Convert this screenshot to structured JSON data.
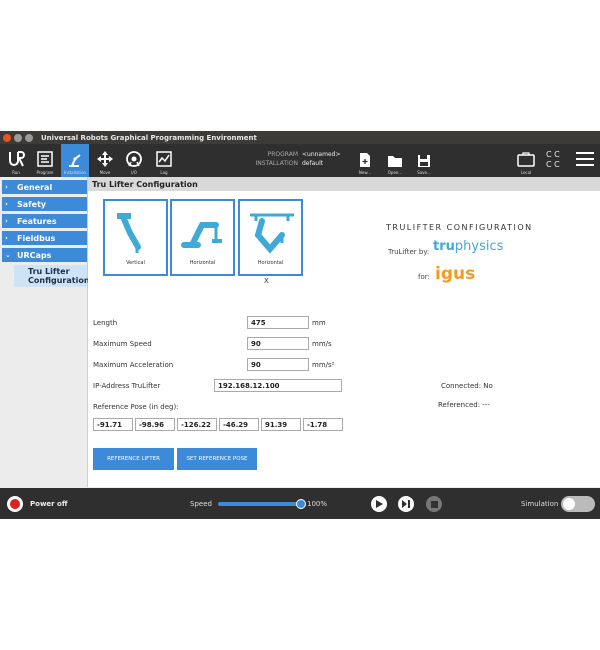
{
  "window": {
    "title": "Universal Robots Graphical Programming Environment"
  },
  "toolbar": {
    "tabs": [
      "Run",
      "Program",
      "Installation",
      "Move",
      "I/O",
      "Log"
    ],
    "program_label": "PROGRAM",
    "program_value": "<unnamed>",
    "installation_label": "INSTALLATION",
    "installation_value": "default",
    "file_actions": [
      "New...",
      "Open...",
      "Save..."
    ],
    "local_label": "Local",
    "cc_text": "C C"
  },
  "sidebar": {
    "items": [
      "General",
      "Safety",
      "Features",
      "Fieldbus",
      "URCaps"
    ],
    "subitem": "Tru Lifter Configuration"
  },
  "content": {
    "header": "Tru Lifter Configuration",
    "cards": [
      "Vertical",
      "Horizontal",
      "Horizontal"
    ],
    "selected_mark": "X",
    "brand_title": "TRULIFTER CONFIGURATION",
    "trulifter_by": "TruLifter by:",
    "tru_logo_bold": "tru",
    "tru_logo_rest": "physics",
    "for_label": "for:",
    "igus_logo": "igus",
    "fields": {
      "length_label": "Length",
      "length_value": "475",
      "length_unit": "mm",
      "speed_label": "Maximum Speed",
      "speed_value": "90",
      "speed_unit": "mm/s",
      "accel_label": "Maximum Acceleration",
      "accel_value": "90",
      "accel_unit": "mm/s²",
      "ip_label": "IP-Address TruLifter",
      "ip_value": "192.168.12.100",
      "pose_label": "Reference Pose (in deg):"
    },
    "status": {
      "connected": "Connected: No",
      "referenced": "Referenced: ---"
    },
    "pose": [
      "-91.71",
      "-98.96",
      "-126.22",
      "-46.29",
      "91.39",
      "-1.78"
    ],
    "buttons": {
      "reference_lifter": "REFERENCE LIFTER",
      "set_reference_pose": "SET REFERENCE POSE"
    }
  },
  "bottom": {
    "power": "Power off",
    "speed_label": "Speed",
    "speed_value": "100%",
    "speed_fraction": 1.0,
    "simulation": "Simulation"
  },
  "colors": {
    "accent": "#3c8ad8",
    "toolbar": "#2f2f2f",
    "igus": "#f59b1f",
    "tru": "#3fa9d8"
  }
}
